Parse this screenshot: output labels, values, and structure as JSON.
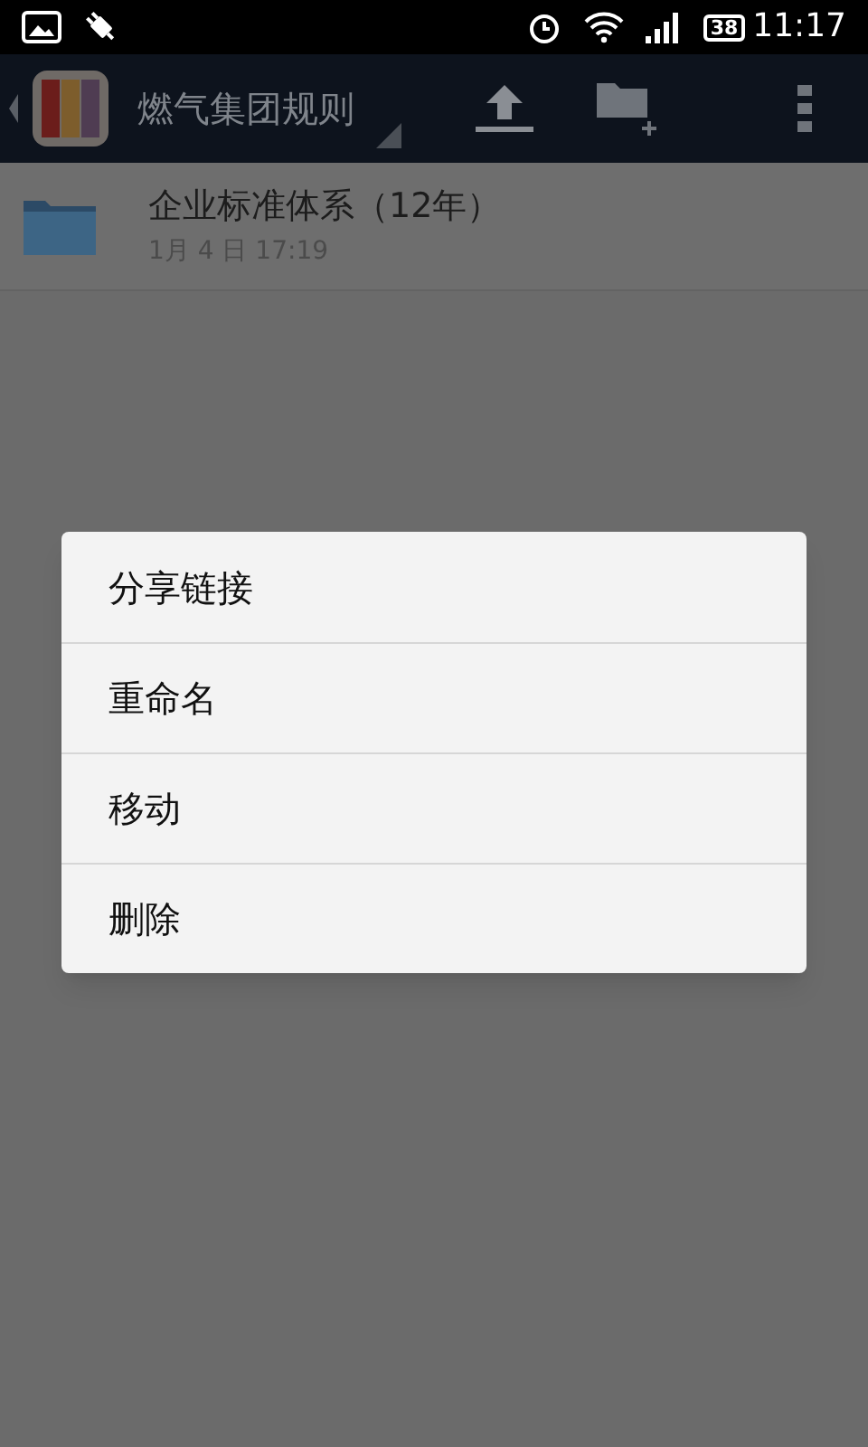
{
  "status_bar": {
    "battery": "38",
    "time": "11:17"
  },
  "action_bar": {
    "title": "燃气集团规则"
  },
  "files": [
    {
      "name": "企业标准体系（12年）",
      "date": "1月 4 日 17:19"
    }
  ],
  "menu": [
    {
      "label": "分享链接"
    },
    {
      "label": "重命名"
    },
    {
      "label": "移动"
    },
    {
      "label": "删除"
    }
  ]
}
